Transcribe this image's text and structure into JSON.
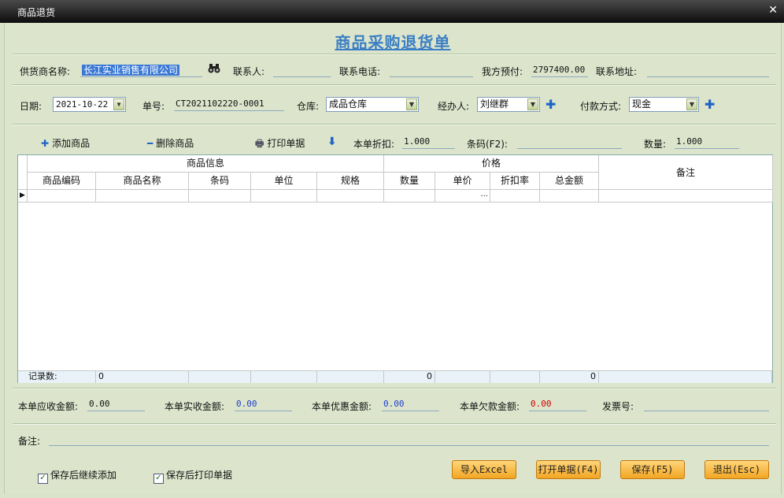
{
  "window": {
    "title": "商品退货",
    "close_glyph": "✕"
  },
  "heading": "商品采购退货单",
  "row1": {
    "supplier_label": "供货商名称:",
    "supplier_value": "长江实业销售有限公司",
    "contact_label": "联系人:",
    "contact_value": "",
    "phone_label": "联系电话:",
    "phone_value": "",
    "prepay_label": "我方预付:",
    "prepay_value": "2797400.00",
    "address_label": "联系地址:",
    "address_value": ""
  },
  "row2": {
    "date_label": "日期:",
    "date_value": "2021-10-22",
    "number_label": "单号:",
    "number_value": "CT2021102220-0001",
    "warehouse_label": "仓库:",
    "warehouse_value": "成品仓库",
    "handler_label": "经办人:",
    "handler_value": "刘继群",
    "payment_label": "付款方式:",
    "payment_value": "现金"
  },
  "toolbar": {
    "add_label": "添加商品",
    "delete_label": "删除商品",
    "print_label": "打印单据",
    "discount_label": "本单折扣:",
    "discount_value": "1.000",
    "barcode_label": "条码(F2):",
    "barcode_value": "",
    "qty_label": "数量:",
    "qty_value": "1.000"
  },
  "grid": {
    "group_product": "商品信息",
    "group_price": "价格",
    "remark_header": "备注",
    "columns": [
      "商品编码",
      "商品名称",
      "条码",
      "单位",
      "规格",
      "数量",
      "单价",
      "折扣率",
      "总金额"
    ],
    "ellipsis": "...",
    "footer_label": "记录数:",
    "footer_count": "0",
    "footer_qty": "0",
    "footer_total": "0"
  },
  "summary": {
    "receivable_label": "本单应收金额:",
    "receivable_value": "0.00",
    "received_label": "本单实收金额:",
    "received_value": "0.00",
    "discount_label": "本单优惠金额:",
    "discount_value": "0.00",
    "owed_label": "本单欠款金额:",
    "owed_value": "0.00",
    "invoice_label": "发票号:",
    "invoice_value": ""
  },
  "remark": {
    "label": "备注:",
    "value": ""
  },
  "options": {
    "continue_add": "保存后继续添加",
    "print_after": "保存后打印单据",
    "check_glyph": "✓"
  },
  "buttons": {
    "import_excel": "导入Excel",
    "open_doc": "打开单据(F4)",
    "save": "保存(F5)",
    "exit": "退出(Esc)"
  },
  "colors": {
    "heading": "#3a7fc4",
    "received_value": "#1f3fd0",
    "discount_value": "#1f3fd0",
    "owed_value": "#d00000",
    "button": "#f2a623"
  }
}
